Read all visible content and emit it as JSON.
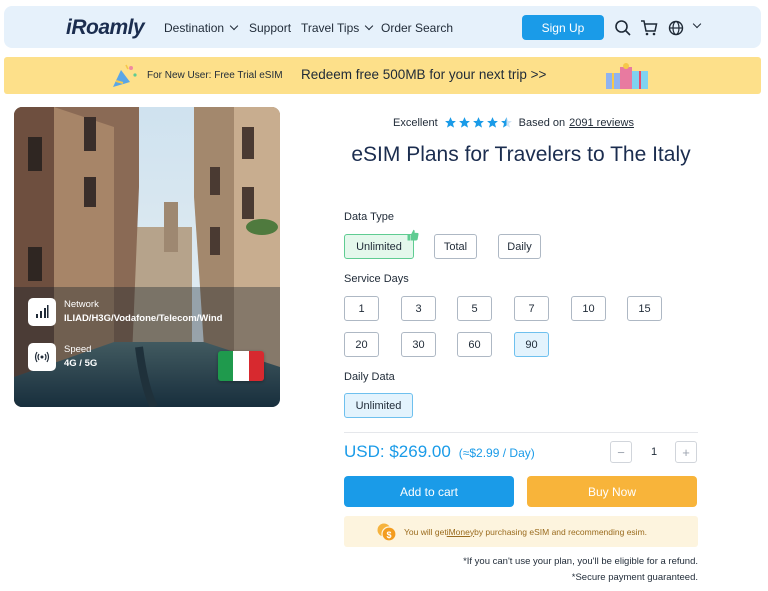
{
  "nav": {
    "logo": "iRoamly",
    "items": [
      {
        "label": "Destination",
        "dropdown": true
      },
      {
        "label": "Support",
        "dropdown": false
      },
      {
        "label": "Travel Tips",
        "dropdown": true
      },
      {
        "label": "Order Search",
        "dropdown": false
      }
    ],
    "signup_label": "Sign Up",
    "icons": [
      "search-icon",
      "cart-icon",
      "globe-icon",
      "chevron-down-icon"
    ]
  },
  "banner": {
    "small_text": "For New User: Free Trial eSIM",
    "big_text": "Redeem free 500MB for your next trip >>"
  },
  "product_card": {
    "network_label": "Network",
    "network_value": "ILIAD/H3G/Vodafone/Telecom/Wind",
    "speed_label": "Speed",
    "speed_value": "4G / 5G",
    "flag_colors": [
      "#1f9a4d",
      "#ffffff",
      "#d7292f"
    ]
  },
  "rating": {
    "label": "Excellent",
    "stars": 4.5,
    "prefix": "Based on",
    "reviews_link": "2091 reviews",
    "star_color": "#1a9be8"
  },
  "title": "eSIM Plans for Travelers to The Italy",
  "data_type": {
    "label": "Data Type",
    "options": [
      "Unlimited",
      "Total",
      "Daily"
    ],
    "selected": "Unlimited"
  },
  "service_days": {
    "label": "Service Days",
    "options": [
      "1",
      "3",
      "5",
      "7",
      "10",
      "15",
      "20",
      "30",
      "60",
      "90"
    ],
    "selected": "90"
  },
  "daily_data": {
    "label": "Daily Data",
    "options": [
      "Unlimited"
    ],
    "selected": "Unlimited"
  },
  "price": {
    "main": "USD: $269.00",
    "per_day": "(≈$2.99 / Day)"
  },
  "quantity": {
    "value": "1",
    "minus": "−",
    "plus": "+"
  },
  "buttons": {
    "add_to_cart": "Add to cart",
    "buy_now": "Buy Now"
  },
  "imoney": {
    "prefix": "You will get ",
    "link": "iMoney",
    "suffix": " by purchasing eSIM and recommending esim."
  },
  "notes": {
    "refund": "*If you can't use your plan, you'll be eligible for a refund.",
    "secure": "*Secure payment guaranteed."
  },
  "colors": {
    "accent": "#1a9be8",
    "buy": "#f8b43a",
    "banner": "#fde08a",
    "nav_bg": "#e6f1fb"
  }
}
